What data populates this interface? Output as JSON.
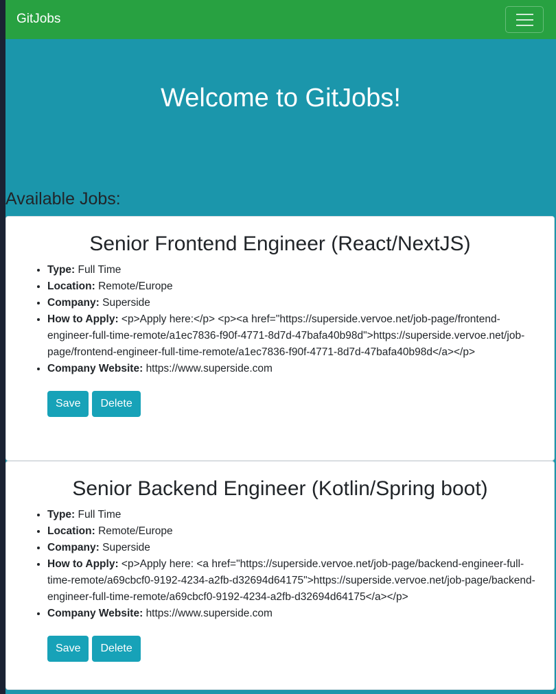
{
  "navbar": {
    "brand": "GitJobs"
  },
  "hero": {
    "title": "Welcome to GitJobs!"
  },
  "section": {
    "title": "Available Jobs:"
  },
  "labels": {
    "type": "Type:",
    "location": "Location:",
    "company": "Company:",
    "how_to_apply": "How to Apply:",
    "company_website": "Company Website:"
  },
  "buttons": {
    "save": "Save",
    "delete": "Delete"
  },
  "jobs": [
    {
      "title": "Senior Frontend Engineer (React/NextJS)",
      "type": "Full Time",
      "location": "Remote/Europe",
      "company": "Superside",
      "how_to_apply": "<p>Apply here:</p> <p><a href=\"https://superside.vervoe.net/job-page/frontend-engineer-full-time-remote/a1ec7836-f90f-4771-8d7d-47bafa40b98d\">https://superside.vervoe.net/job-page/frontend-engineer-full-time-remote/a1ec7836-f90f-4771-8d7d-47bafa40b98d</a></p>",
      "company_website": "https://www.superside.com"
    },
    {
      "title": "Senior Backend Engineer (Kotlin/Spring boot)",
      "type": "Full Time",
      "location": "Remote/Europe",
      "company": "Superside",
      "how_to_apply": "<p>Apply here: <a href=\"https://superside.vervoe.net/job-page/backend-engineer-full-time-remote/a69cbcf0-9192-4234-a2fb-d32694d64175\">https://superside.vervoe.net/job-page/backend-engineer-full-time-remote/a69cbcf0-9192-4234-a2fb-d32694d64175</a></p>",
      "company_website": "https://www.superside.com"
    }
  ]
}
